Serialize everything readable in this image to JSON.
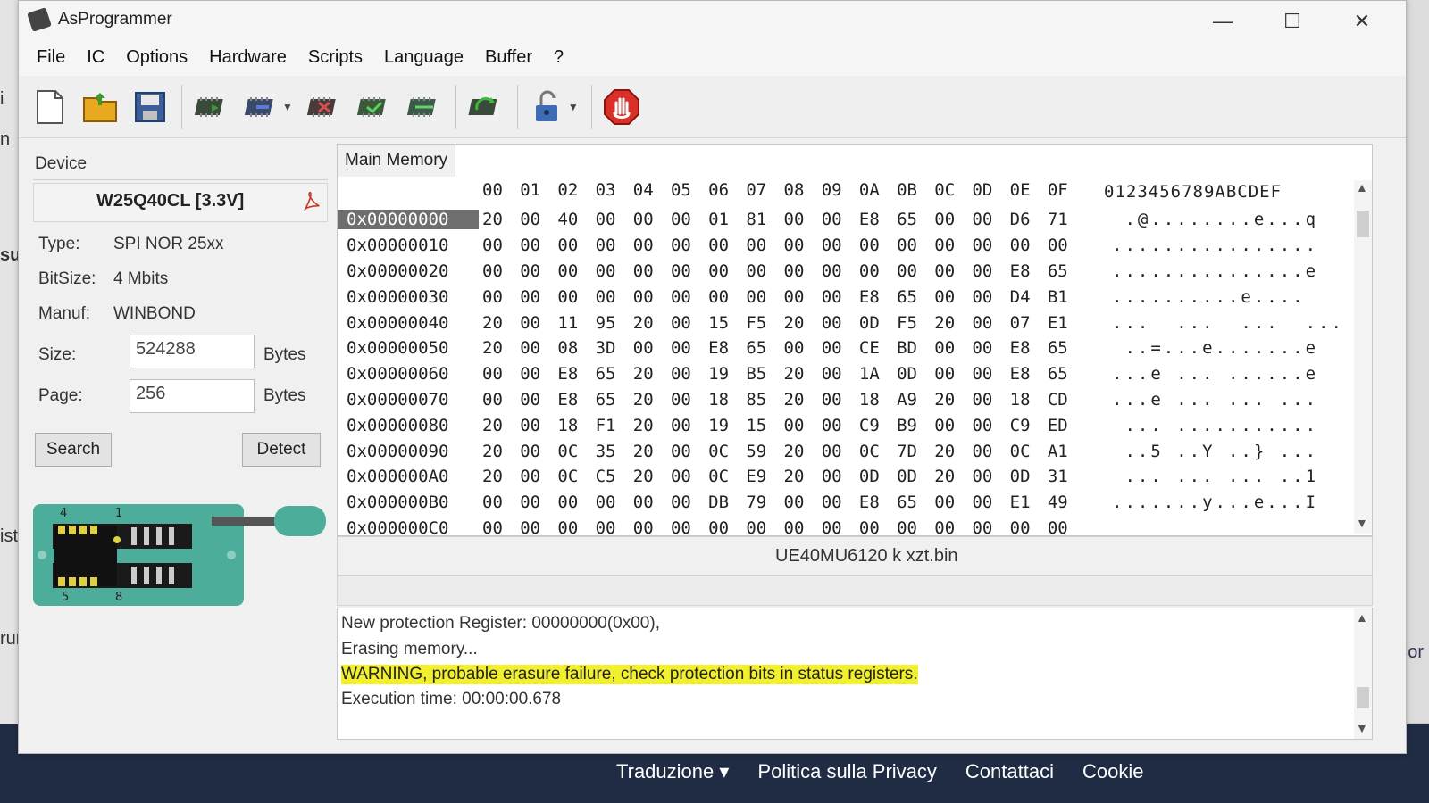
{
  "window": {
    "title": "AsProgrammer",
    "controls": [
      "—",
      "☐",
      "✕"
    ]
  },
  "menu": [
    "File",
    "IC",
    "Options",
    "Hardware",
    "Scripts",
    "Language",
    "Buffer",
    "?"
  ],
  "toolbar_icons": [
    "new-file-icon",
    "open-folder-icon",
    "save-icon",
    "read-chip-icon",
    "write-chip-icon",
    "erase-chip-icon",
    "verify-chip-icon",
    "blank-check-icon",
    "auto-program-icon",
    "unlock-icon",
    "stop-icon"
  ],
  "device": {
    "legend": "Device",
    "name": "W25Q40CL [3.3V]",
    "type_label": "Type:",
    "type_value": "SPI NOR 25xx",
    "bitsize_label": "BitSize:",
    "bitsize_value": "4 Mbits",
    "manuf_label": "Manuf:",
    "manuf_value": "WINBOND",
    "size_label": "Size:",
    "size_value": "524288",
    "size_unit": "Bytes",
    "page_label": "Page:",
    "page_value": "256",
    "page_unit": "Bytes",
    "search_label": "Search",
    "detect_label": "Detect",
    "chip_pins": [
      "4",
      "1",
      "5",
      "8"
    ]
  },
  "hex": {
    "tab": "Main Memory",
    "columns": [
      "00",
      "01",
      "02",
      "03",
      "04",
      "05",
      "06",
      "07",
      "08",
      "09",
      "0A",
      "0B",
      "0C",
      "0D",
      "0E",
      "0F"
    ],
    "ascii_header": "0123456789ABCDEF",
    "rows": [
      {
        "addr": "0x00000000",
        "bytes": [
          "20",
          "00",
          "40",
          "00",
          "00",
          "00",
          "01",
          "81",
          "00",
          "00",
          "E8",
          "65",
          "00",
          "00",
          "D6",
          "71"
        ],
        "ascii": " .@........e...q"
      },
      {
        "addr": "0x00000010",
        "bytes": [
          "00",
          "00",
          "00",
          "00",
          "00",
          "00",
          "00",
          "00",
          "00",
          "00",
          "00",
          "00",
          "00",
          "00",
          "00",
          "00"
        ],
        "ascii": "................"
      },
      {
        "addr": "0x00000020",
        "bytes": [
          "00",
          "00",
          "00",
          "00",
          "00",
          "00",
          "00",
          "00",
          "00",
          "00",
          "00",
          "00",
          "00",
          "00",
          "E8",
          "65"
        ],
        "ascii": "...............e"
      },
      {
        "addr": "0x00000030",
        "bytes": [
          "00",
          "00",
          "00",
          "00",
          "00",
          "00",
          "00",
          "00",
          "00",
          "00",
          "E8",
          "65",
          "00",
          "00",
          "D4",
          "B1"
        ],
        "ascii": "..........e...."
      },
      {
        "addr": "0x00000040",
        "bytes": [
          "20",
          "00",
          "11",
          "95",
          "20",
          "00",
          "15",
          "F5",
          "20",
          "00",
          "0D",
          "F5",
          "20",
          "00",
          "07",
          "E1"
        ],
        "ascii": "...  ...  ...  ..."
      },
      {
        "addr": "0x00000050",
        "bytes": [
          "20",
          "00",
          "08",
          "3D",
          "00",
          "00",
          "E8",
          "65",
          "00",
          "00",
          "CE",
          "BD",
          "00",
          "00",
          "E8",
          "65"
        ],
        "ascii": " ..=...e.......e"
      },
      {
        "addr": "0x00000060",
        "bytes": [
          "00",
          "00",
          "E8",
          "65",
          "20",
          "00",
          "19",
          "B5",
          "20",
          "00",
          "1A",
          "0D",
          "00",
          "00",
          "E8",
          "65"
        ],
        "ascii": "...e ... ......e"
      },
      {
        "addr": "0x00000070",
        "bytes": [
          "00",
          "00",
          "E8",
          "65",
          "20",
          "00",
          "18",
          "85",
          "20",
          "00",
          "18",
          "A9",
          "20",
          "00",
          "18",
          "CD"
        ],
        "ascii": "...e ... ... ..."
      },
      {
        "addr": "0x00000080",
        "bytes": [
          "20",
          "00",
          "18",
          "F1",
          "20",
          "00",
          "19",
          "15",
          "00",
          "00",
          "C9",
          "B9",
          "00",
          "00",
          "C9",
          "ED"
        ],
        "ascii": " ... ..........."
      },
      {
        "addr": "0x00000090",
        "bytes": [
          "20",
          "00",
          "0C",
          "35",
          "20",
          "00",
          "0C",
          "59",
          "20",
          "00",
          "0C",
          "7D",
          "20",
          "00",
          "0C",
          "A1"
        ],
        "ascii": " ..5 ..Y ..} ..."
      },
      {
        "addr": "0x000000A0",
        "bytes": [
          "20",
          "00",
          "0C",
          "C5",
          "20",
          "00",
          "0C",
          "E9",
          "20",
          "00",
          "0D",
          "0D",
          "20",
          "00",
          "0D",
          "31"
        ],
        "ascii": " ... ... ... ..1"
      },
      {
        "addr": "0x000000B0",
        "bytes": [
          "00",
          "00",
          "00",
          "00",
          "00",
          "00",
          "DB",
          "79",
          "00",
          "00",
          "E8",
          "65",
          "00",
          "00",
          "E1",
          "49"
        ],
        "ascii": ".......y...e...I"
      },
      {
        "addr": "0x000000C0",
        "bytes": [
          "00",
          "00",
          "00",
          "00",
          "00",
          "00",
          "00",
          "00",
          "00",
          "00",
          "00",
          "00",
          "00",
          "00",
          "00",
          "00"
        ],
        "ascii": ""
      }
    ]
  },
  "status": {
    "filename": "UE40MU6120 k xzt.bin"
  },
  "log": {
    "lines": [
      "New protection Register: 00000000(0x00),",
      "Erasing memory...",
      "WARNING, probable erasure failure, check protection bits in status registers.",
      "Execution time: 00:00:00.678"
    ]
  },
  "background_page": {
    "left_fragments": [
      "i",
      "n",
      "su",
      "ista",
      "rum"
    ],
    "right_fragment": "Cor",
    "footer_links": [
      "Traduzione ▾",
      "Politica sulla Privacy",
      "Contattaci",
      "Cookie"
    ]
  },
  "colors": {
    "footer": "#1f2c44",
    "warning_highlight": "#f2ef2e",
    "selected_address": "#6e6e6e",
    "stop_red": "#d9302a"
  }
}
